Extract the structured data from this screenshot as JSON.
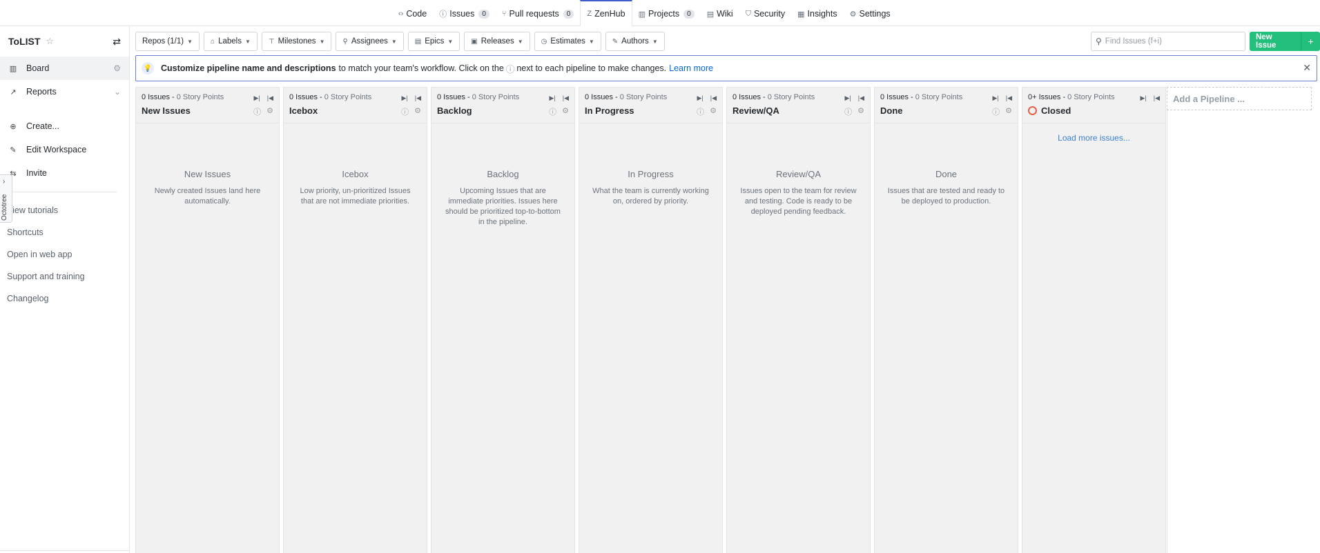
{
  "topnav": {
    "tabs": [
      {
        "icon": "code-icon",
        "glyph": "‹›",
        "label": "Code",
        "count": ""
      },
      {
        "icon": "issue-icon",
        "glyph": "ⓘ",
        "label": "Issues",
        "count": "0"
      },
      {
        "icon": "pull-request-icon",
        "glyph": "⑂",
        "label": "Pull requests",
        "count": "0"
      },
      {
        "icon": "zenhub-icon",
        "glyph": "Z",
        "label": "ZenHub",
        "count": "",
        "active": true
      },
      {
        "icon": "projects-icon",
        "glyph": "▥",
        "label": "Projects",
        "count": "0"
      },
      {
        "icon": "wiki-icon",
        "glyph": "▤",
        "label": "Wiki",
        "count": ""
      },
      {
        "icon": "shield-icon",
        "glyph": "⛉",
        "label": "Security",
        "count": ""
      },
      {
        "icon": "graph-icon",
        "glyph": "▦",
        "label": "Insights",
        "count": ""
      },
      {
        "icon": "gear-icon",
        "glyph": "⚙",
        "label": "Settings",
        "count": ""
      }
    ]
  },
  "sidebar": {
    "workspace_title": "ToLIST",
    "items": [
      {
        "icon": "board-icon",
        "glyph": "▥",
        "label": "Board",
        "right": "⚙"
      },
      {
        "icon": "reports-icon",
        "glyph": "↗",
        "label": "Reports",
        "right": "⌄"
      },
      {
        "icon": "create-icon",
        "glyph": "⊕",
        "label": "Create...",
        "right": ""
      },
      {
        "icon": "edit-icon",
        "glyph": "✎",
        "label": "Edit Workspace",
        "right": ""
      },
      {
        "icon": "invite-icon",
        "glyph": "⇆",
        "label": "Invite",
        "right": ""
      }
    ],
    "links": [
      "View tutorials",
      "Shortcuts",
      "Open in web app",
      "Support and training",
      "Changelog"
    ],
    "octotree_label": "Octotree"
  },
  "filters": {
    "buttons": [
      {
        "icon": "",
        "label": "Repos (1/1)"
      },
      {
        "icon": "⌂",
        "label": "Labels"
      },
      {
        "icon": "⊤",
        "label": "Milestones"
      },
      {
        "icon": "⚲",
        "label": "Assignees"
      },
      {
        "icon": "▤",
        "label": "Epics"
      },
      {
        "icon": "▣",
        "label": "Releases"
      },
      {
        "icon": "◷",
        "label": "Estimates"
      },
      {
        "icon": "✎",
        "label": "Authors"
      }
    ],
    "search_placeholder": "Find Issues (f+i)",
    "new_issue_label": "New Issue"
  },
  "banner": {
    "bold": "Customize pipeline name and descriptions",
    "text_before": "to match your team's workflow. Click on the",
    "text_after": "next to each pipeline to make changes.",
    "link": "Learn more"
  },
  "pipelines": [
    {
      "issues": "0 Issues",
      "points": "0 Story Points",
      "name": "New Issues",
      "title": "New Issues",
      "desc": "Newly created Issues land here automatically."
    },
    {
      "issues": "0 Issues",
      "points": "0 Story Points",
      "name": "Icebox",
      "title": "Icebox",
      "desc": "Low priority, un-prioritized Issues that are not immediate priorities."
    },
    {
      "issues": "0 Issues",
      "points": "0 Story Points",
      "name": "Backlog",
      "title": "Backlog",
      "desc": "Upcoming Issues that are immediate priorities. Issues here should be prioritized top-to-bottom in the pipeline."
    },
    {
      "issues": "0 Issues",
      "points": "0 Story Points",
      "name": "In Progress",
      "title": "In Progress",
      "desc": "What the team is currently working on, ordered by priority."
    },
    {
      "issues": "0 Issues",
      "points": "0 Story Points",
      "name": "Review/QA",
      "title": "Review/QA",
      "desc": "Issues open to the team for review and testing. Code is ready to be deployed pending feedback."
    },
    {
      "issues": "0 Issues",
      "points": "0 Story Points",
      "name": "Done",
      "title": "Done",
      "desc": "Issues that are tested and ready to be deployed to production."
    },
    {
      "issues": "0+ Issues",
      "points": "0 Story Points",
      "name": "Closed",
      "title": "",
      "desc": "",
      "load_more": "Load more issues..."
    }
  ],
  "add_pipeline": "Add a Pipeline ...",
  "colors": {
    "accent": "#22c07a",
    "banner_border": "#6c7bd6",
    "link": "#0366d6",
    "closed": "#e36049"
  }
}
